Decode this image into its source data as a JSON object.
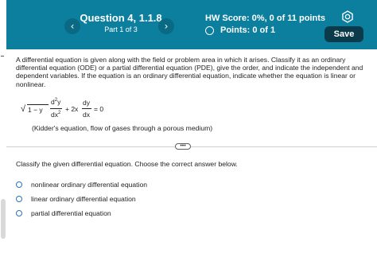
{
  "header": {
    "question_title": "Question 4, 1.1.8",
    "part": "Part 1 of 3",
    "hw_score": "HW Score: 0%, 0 of 11 points",
    "points": "Points: 0 of 1",
    "save_label": "Save",
    "prev_icon": "‹",
    "next_icon": "›",
    "colors": {
      "bar": "#0d7f9e",
      "save": "#0b3b4b"
    }
  },
  "question": {
    "prompt": "A differential equation is given along with the field or problem area in which it arises. Classify it as an ordinary differential equation (ODE) or a partial differential equation (PDE), give the order, and indicate the independent and dependent variables. If the equation is an ordinary differential equation, indicate whether the equation is linear or nonlinear.",
    "equation": {
      "sqrt": "√",
      "radicand": "1 − y",
      "num1": "d",
      "num1_sup": "2",
      "num1_var": "y",
      "den1": "dx",
      "den1_sup": "2",
      "plus": "+ 2x",
      "num2": "dy",
      "den2": "dx",
      "equals": "= 0"
    },
    "caption": "(Kidder's equation, flow of gases through a porous medium)"
  },
  "expand_label": "•••",
  "instruction": "Classify the given differential equation. Choose the correct answer below.",
  "options": [
    "nonlinear ordinary differential equation",
    "linear ordinary differential equation",
    "partial differential equation"
  ]
}
